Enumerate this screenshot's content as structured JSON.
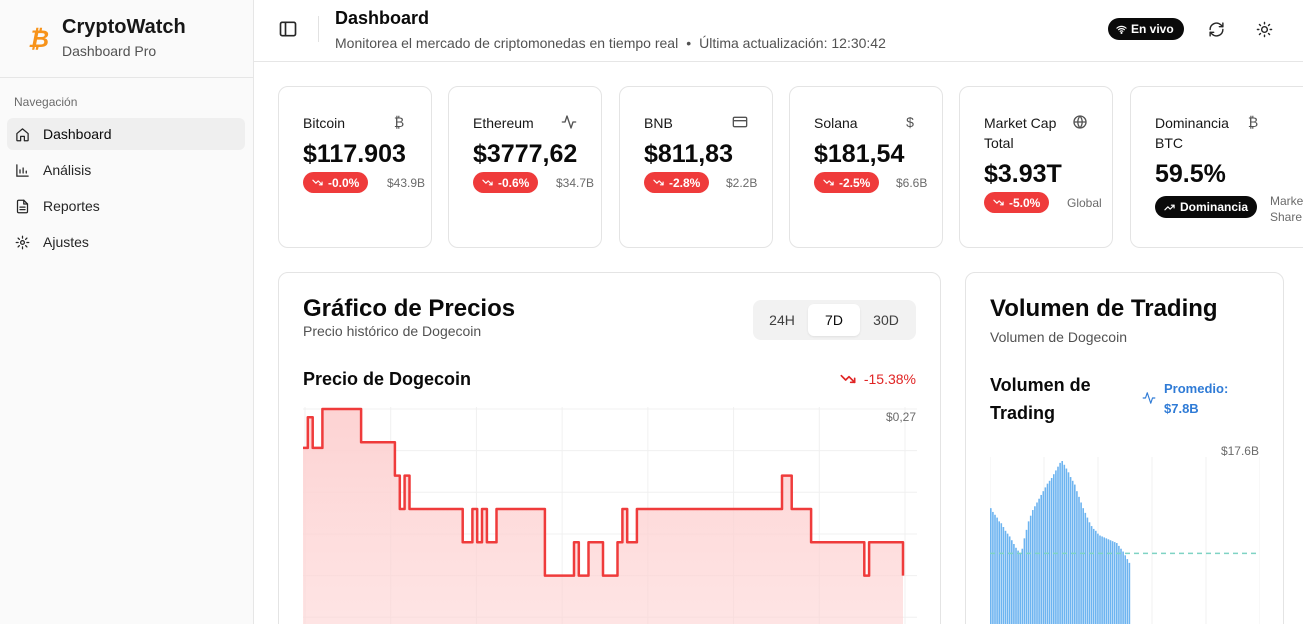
{
  "brand": {
    "title": "CryptoWatch",
    "subtitle": "Dashboard Pro",
    "logo_icon": "bitcoin-icon",
    "logo_color": "#f7931a"
  },
  "sidebar": {
    "heading": "Navegación",
    "items": [
      {
        "label": "Dashboard",
        "icon": "home-icon",
        "active": true
      },
      {
        "label": "Análisis",
        "icon": "bar-chart-icon",
        "active": false
      },
      {
        "label": "Reportes",
        "icon": "file-text-icon",
        "active": false
      },
      {
        "label": "Ajustes",
        "icon": "gear-icon",
        "active": false
      }
    ]
  },
  "header": {
    "title": "Dashboard",
    "subtitle": "Monitorea el mercado de criptomonedas en tiempo real",
    "separator": "•",
    "updated": "Última actualización: 12:30:42",
    "live_label": "En vivo"
  },
  "cards": [
    {
      "name": "Bitcoin",
      "icon": "bitcoin-icon",
      "value": "$117.903",
      "change": "-0.0%",
      "extra": "$43.9B"
    },
    {
      "name": "Ethereum",
      "icon": "activity-icon",
      "value": "$3777,62",
      "change": "-0.6%",
      "extra": "$34.7B"
    },
    {
      "name": "BNB",
      "icon": "credit-card-icon",
      "value": "$811,83",
      "change": "-2.8%",
      "extra": "$2.2B"
    },
    {
      "name": "Solana",
      "icon": "dollar-icon",
      "value": "$181,54",
      "change": "-2.5%",
      "extra": "$6.6B"
    },
    {
      "name": "Market Cap Total",
      "icon": "globe-icon",
      "value": "$3.93T",
      "change": "-5.0%",
      "extra": "Global"
    },
    {
      "name": "Dominancia BTC",
      "icon": "bitcoin-icon",
      "value": "59.5%",
      "change": "Dominancia",
      "extra": "Market Share"
    }
  ],
  "price_panel": {
    "title": "Gráfico de Precios",
    "subtitle": "Precio histórico de Dogecoin",
    "ranges": [
      "24H",
      "7D",
      "30D"
    ],
    "selected_range": "7D",
    "chart_title": "Precio de Dogecoin",
    "change": "-15.38%",
    "y_top_label": "$0,27",
    "line_color": "#ef3b3b",
    "fill_color": "#fdd3d3"
  },
  "volume_panel": {
    "title": "Volumen de Trading",
    "subtitle": "Volumen de Dogecoin",
    "chart_title": "Volumen de Trading",
    "average": "Promedio: $7.8B",
    "y_top_label": "$17.6B",
    "bar_color": "#6db4f0",
    "avg_line_color": "#7fd3c4"
  },
  "chart_data": [
    {
      "type": "area",
      "title": "Precio de Dogecoin",
      "y_top_tick": "$0,27",
      "visible_note": "only the upper portion of the chart is visible",
      "values": [
        0.263,
        0.2685,
        0.263,
        0.263,
        0.27,
        0.27,
        0.27,
        0.27,
        0.27,
        0.27,
        0.27,
        0.27,
        0.264,
        0.264,
        0.264,
        0.264,
        0.264,
        0.264,
        0.264,
        0.258,
        0.252,
        0.258,
        0.252,
        0.252,
        0.252,
        0.252,
        0.252,
        0.252,
        0.252,
        0.252,
        0.252,
        0.252,
        0.252,
        0.246,
        0.246,
        0.252,
        0.246,
        0.252,
        0.246,
        0.246,
        0.252,
        0.252,
        0.252,
        0.252,
        0.252,
        0.252,
        0.252,
        0.252,
        0.252,
        0.252,
        0.24,
        0.24,
        0.24,
        0.24,
        0.24,
        0.24,
        0.246,
        0.24,
        0.24,
        0.246,
        0.246,
        0.246,
        0.24,
        0.24,
        0.24,
        0.246,
        0.252,
        0.246,
        0.246,
        0.252,
        0.252,
        0.252,
        0.252,
        0.252,
        0.252,
        0.252,
        0.252,
        0.252,
        0.252,
        0.252,
        0.252,
        0.252,
        0.252,
        0.252,
        0.252,
        0.252,
        0.252,
        0.252,
        0.252,
        0.252,
        0.252,
        0.252,
        0.252,
        0.252,
        0.252,
        0.252,
        0.252,
        0.252,
        0.252,
        0.258,
        0.258,
        0.252,
        0.252,
        0.252,
        0.252,
        0.246,
        0.246,
        0.246,
        0.246,
        0.246,
        0.246,
        0.246,
        0.246,
        0.246,
        0.246,
        0.246,
        0.24,
        0.246,
        0.246,
        0.246,
        0.246,
        0.246,
        0.246,
        0.246,
        0.24
      ]
    },
    {
      "type": "bar",
      "title": "Volumen de Trading",
      "y_top_tick": "$17.6B",
      "average": 7.8,
      "unit": "B",
      "values": [
        12.6,
        12.2,
        11.9,
        11.6,
        11.2,
        11.0,
        10.6,
        10.2,
        9.9,
        9.6,
        9.2,
        8.8,
        8.4,
        8.1,
        7.8,
        8.3,
        9.4,
        10.3,
        11.2,
        11.8,
        12.4,
        12.8,
        13.2,
        13.6,
        14.0,
        14.4,
        14.8,
        15.2,
        15.5,
        15.8,
        16.2,
        16.6,
        17.0,
        17.4,
        17.6,
        17.2,
        16.8,
        16.4,
        15.9,
        15.5,
        15.1,
        14.4,
        13.8,
        13.2,
        12.6,
        12.1,
        11.6,
        11.1,
        10.7,
        10.4,
        10.2,
        9.9,
        9.7,
        9.6,
        9.5,
        9.4,
        9.3,
        9.2,
        9.1,
        9.0,
        8.9,
        8.6,
        8.3,
        8.0,
        7.6,
        7.2,
        6.8
      ]
    }
  ]
}
